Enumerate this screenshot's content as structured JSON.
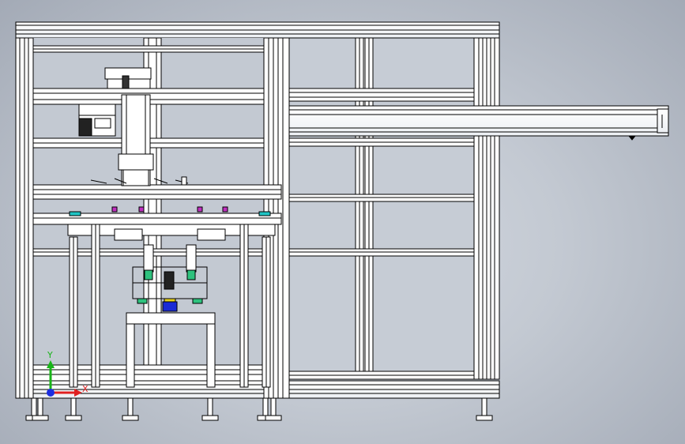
{
  "viewport": {
    "background_top": "#d4d9e1",
    "background_edge": "#a3aab6"
  },
  "model": {
    "frame_color": "#ffffff",
    "line_color": "#000000",
    "panel_color": "#c4cad3"
  },
  "parts": {
    "sensor_green": "#2ec27e",
    "clamp_blue": "#1b2bd6",
    "pad_yellow": "#e8d21a",
    "marker_magenta": "#c02fc0",
    "marker_cyan": "#1fc4c4"
  },
  "triad": {
    "x_label": "X",
    "y_label": "Y",
    "x_color": "#e02020",
    "y_color": "#18b418",
    "z_color": "#1c2ee0"
  }
}
